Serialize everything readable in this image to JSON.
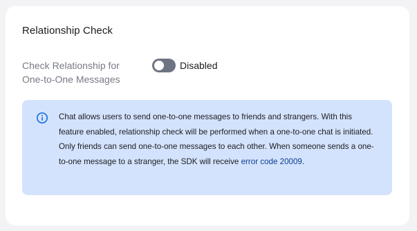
{
  "section": {
    "title": "Relationship Check"
  },
  "setting": {
    "label": "Check Relationship for One-to-One Messages",
    "toggle_state": "off",
    "status_text": "Disabled"
  },
  "info": {
    "icon": "info-circle-icon",
    "text": "Chat allows users to send one-to-one messages to friends and strangers. With this feature enabled, relationship check will be performed when a one-to-one chat is initiated. Only friends can send one-to-one messages to each other. When someone sends a one-to-one message to a stranger, the SDK will receive ",
    "link_text": "error code 20009",
    "trailing_text": "."
  },
  "colors": {
    "info_background": "#d4e3fd",
    "info_icon": "#1a73e8",
    "link": "#0b3d91",
    "toggle_off": "#6f7483"
  }
}
